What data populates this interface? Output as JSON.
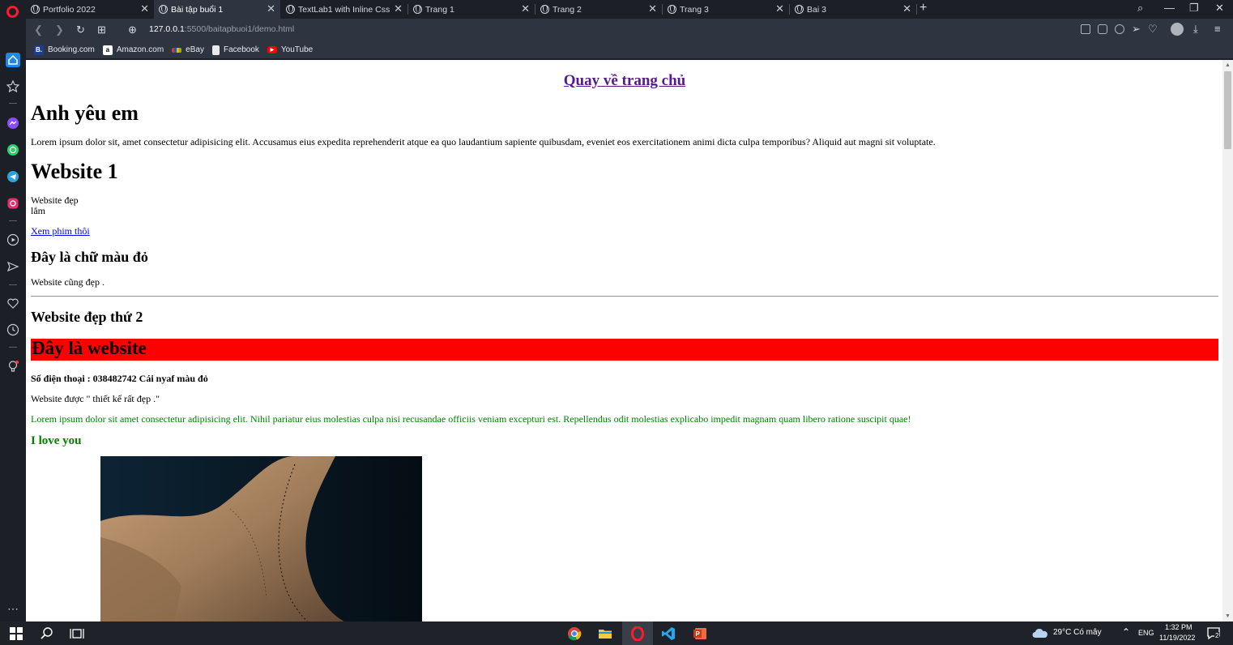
{
  "browser": {
    "tabs": [
      {
        "label": "Portfolio 2022",
        "active": false
      },
      {
        "label": "Bài tập buổi 1",
        "active": true
      },
      {
        "label": "TextLab1 with Inline Css",
        "active": false
      },
      {
        "label": "Trang 1",
        "active": false
      },
      {
        "label": "Trang 2",
        "active": false
      },
      {
        "label": "Trang 3",
        "active": false
      },
      {
        "label": "Bai 3",
        "active": false
      }
    ],
    "url_host": "127.0.0.1",
    "url_rest": ":5500/baitapbuoi1/demo.html",
    "bookmarks": [
      {
        "label": "Booking.com",
        "icon": "booking-icon",
        "color": "#1b3f8f",
        "glyph": "B."
      },
      {
        "label": "Amazon.com",
        "icon": "amazon-icon",
        "color": "#ffffff",
        "glyph": "a"
      },
      {
        "label": "eBay",
        "icon": "ebay-icon",
        "color": "#e53238",
        "glyph": ""
      },
      {
        "label": "Facebook",
        "icon": "page-icon",
        "color": "#e8eaed",
        "glyph": ""
      },
      {
        "label": "YouTube",
        "icon": "youtube-icon",
        "color": "#ff0000",
        "glyph": "▶"
      }
    ]
  },
  "page": {
    "home_link": "Quay về trang chủ",
    "heading1": "Anh yêu em",
    "para1": "Lorem ipsum dolor sit, amet consectetur adipisicing elit. Accusamus eius expedita reprehenderit atque ea quo laudantium sapiente quibusdam, eveniet eos exercitationem animi dicta culpa temporibus? Aliquid aut magni sit voluptate.",
    "heading2": "Website 1",
    "pre_line1": "Website đẹp",
    "pre_line2": "lắm",
    "movie_link": "Xem phim thôi",
    "red_text_heading": "Đây là chữ màu đỏ",
    "para2": "Website cũng đẹp .",
    "heading3": "Website đẹp thứ 2",
    "banner": "Đây là website",
    "phone": "Số điện thoại : 038482742 Cái nyaf màu đỏ",
    "para3": "Website được \" thiết kế rất đẹp .\"",
    "para4": "Lorem ipsum dolor sit amet consectetur adipisicing elit. Nihil pariatur eius molestias culpa nisi recusandae officiis veniam excepturi est. Repellendus odit molestias explicabo impedit magnam quam libero ratione suscipit quae!",
    "love": "I love you",
    "colors": {
      "banner": "#ff0000",
      "green": "#008000",
      "visited": "#551a8b",
      "link": "#0000ee"
    }
  },
  "taskbar": {
    "weather": "29°C  Có mây",
    "lang": "ENG",
    "time": "1:32 PM",
    "date": "11/19/2022",
    "notif_count": "2"
  }
}
